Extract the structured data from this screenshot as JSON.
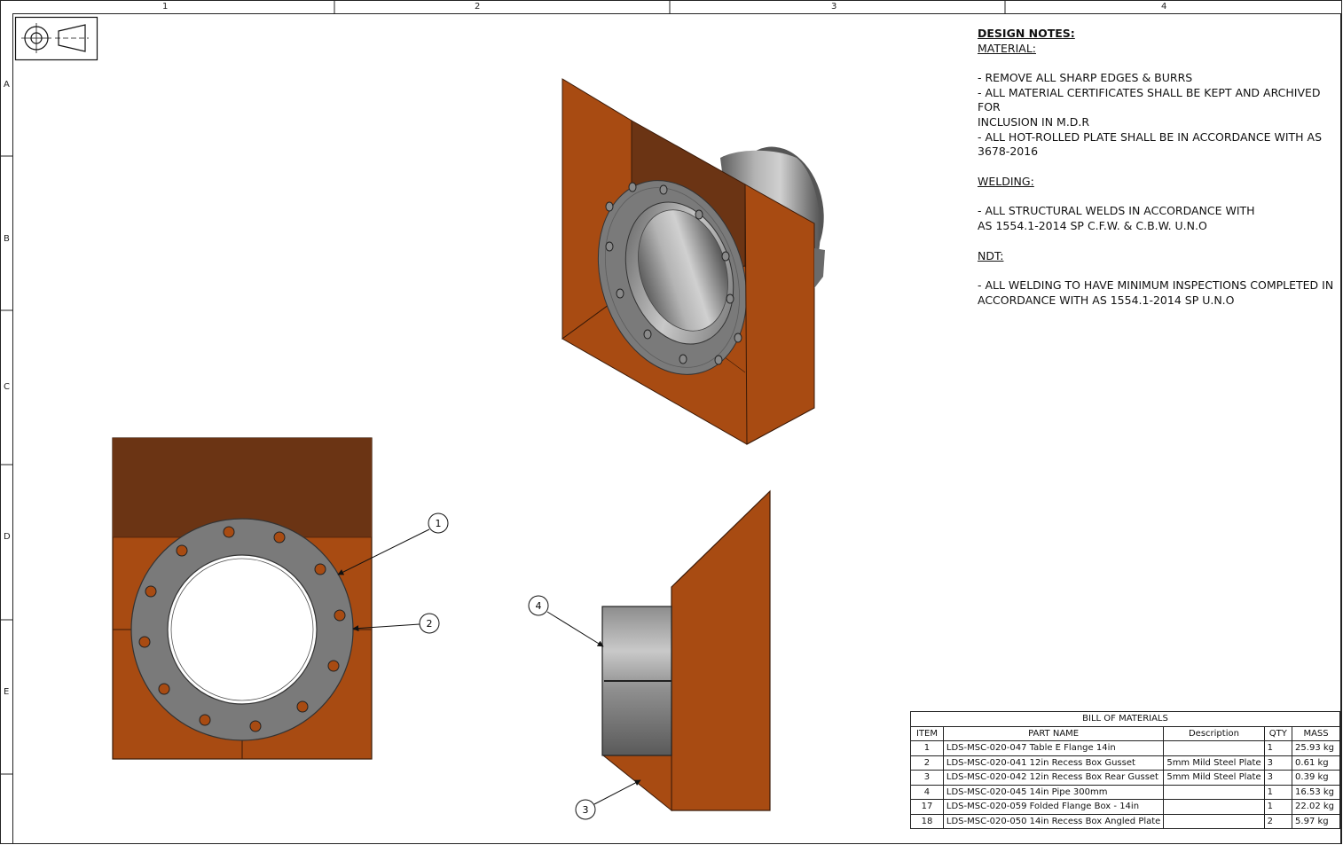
{
  "border": {
    "columns": [
      "1",
      "2",
      "3",
      "4"
    ],
    "rows": [
      "A",
      "B",
      "C",
      "D",
      "E"
    ]
  },
  "design_notes": {
    "title": "DESIGN NOTES:",
    "material_heading": "MATERIAL:",
    "material_lines": [
      "- REMOVE ALL SHARP EDGES & BURRS",
      "- ALL MATERIAL CERTIFICATES SHALL BE KEPT AND ARCHIVED FOR",
      "INCLUSION IN M.D.R",
      "- ALL HOT-ROLLED PLATE SHALL BE IN ACCORDANCE WITH AS",
      "3678-2016"
    ],
    "welding_heading": "WELDING:",
    "welding_lines": [
      "- ALL STRUCTURAL WELDS IN ACCORDANCE WITH",
      "AS 1554.1-2014 SP C.F.W. & C.B.W. U.N.O"
    ],
    "ndt_heading": "NDT:",
    "ndt_lines": [
      "- ALL WELDING TO HAVE MINIMUM INSPECTIONS COMPLETED IN",
      "ACCORDANCE WITH AS 1554.1-2014 SP U.N.O"
    ]
  },
  "balloons": [
    "1",
    "2",
    "3",
    "4"
  ],
  "bom": {
    "title": "BILL OF MATERIALS",
    "headers": [
      "ITEM",
      "PART NAME",
      "Description",
      "QTY",
      "MASS"
    ],
    "rows": [
      [
        "1",
        "LDS-MSC-020-047 Table E Flange 14in",
        "",
        "1",
        "25.93 kg"
      ],
      [
        "2",
        "LDS-MSC-020-041 12in Recess Box Gusset",
        "5mm Mild Steel Plate",
        "3",
        "0.61 kg"
      ],
      [
        "3",
        "LDS-MSC-020-042 12in Recess Box Rear Gusset",
        "5mm Mild Steel Plate",
        "3",
        "0.39 kg"
      ],
      [
        "4",
        "LDS-MSC-020-045 14in Pipe 300mm",
        "",
        "1",
        "16.53 kg"
      ],
      [
        "17",
        "LDS-MSC-020-059 Folded Flange Box - 14in",
        "",
        "1",
        "22.02 kg"
      ],
      [
        "18",
        "LDS-MSC-020-050 14in Recess Box Angled Plate",
        "",
        "2",
        "5.97 kg"
      ]
    ]
  },
  "colors": {
    "plate": "#A84B12",
    "plate_dark": "#6B3414",
    "steel": "#7A7A7A",
    "steel_light": "#A8A8A8"
  }
}
